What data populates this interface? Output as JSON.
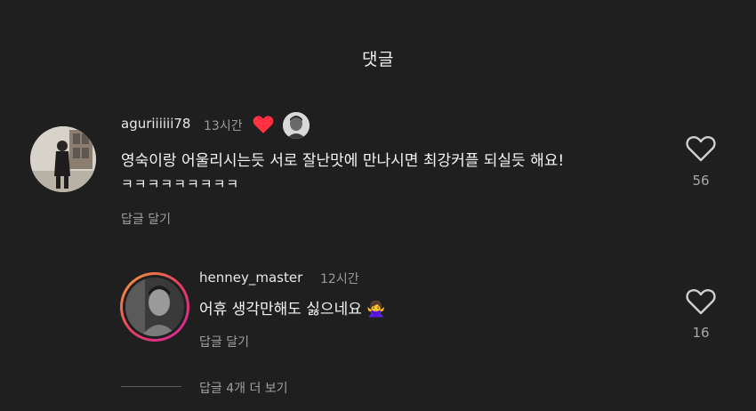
{
  "header": {
    "title": "댓글"
  },
  "comment": {
    "username": "aguriiiiii78",
    "time": "13시간",
    "line1": "영숙이랑 어울리시는듯 서로 잘난맛에 만나시면 최강커플 되실듯 해요!",
    "line2": "ㅋㅋㅋㅋㅋㅋㅋㅋㅋ",
    "reply_label": "답글 달기",
    "like_count": "56"
  },
  "reply": {
    "username": "henney_master",
    "time": "12시간",
    "text": "어휴 생각만해도 싫으네요",
    "emoji": "🙅‍♀️",
    "reply_label": "답글 달기",
    "like_count": "16"
  },
  "more_replies_label": "답글 4개 더 보기",
  "colors": {
    "background": "#1f1f1f",
    "liked_heart": "#ff3040",
    "story_ring_start": "#f9a13a",
    "story_ring_end": "#d6249f"
  }
}
